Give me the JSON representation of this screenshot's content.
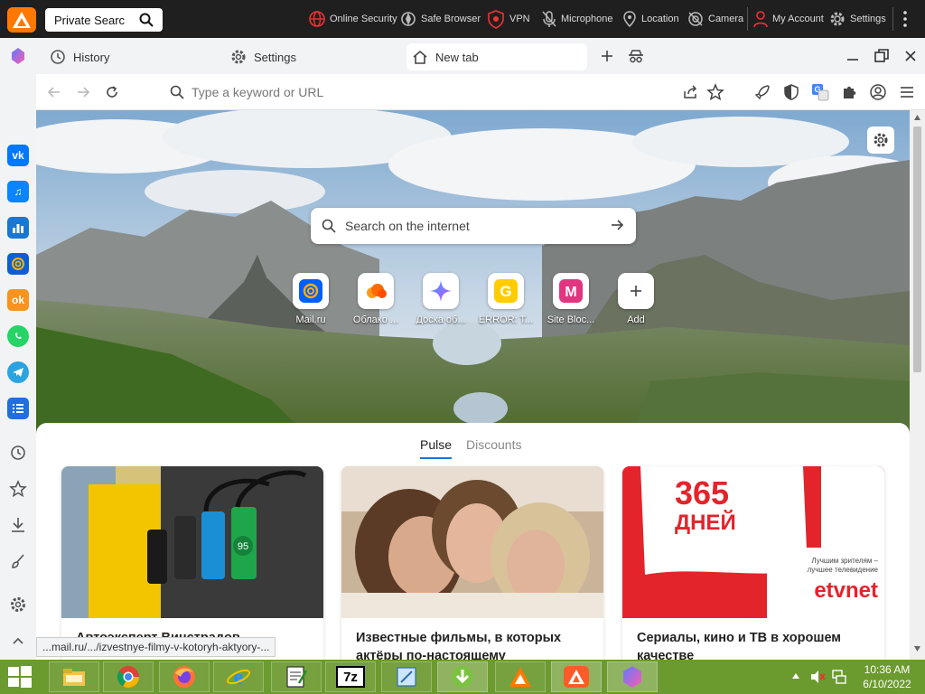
{
  "topbar": {
    "search_value": "Private Searc",
    "items": [
      {
        "label": "Online Security"
      },
      {
        "label": "Safe Browser"
      },
      {
        "label": "VPN"
      },
      {
        "label": "Microphone"
      },
      {
        "label": "Location"
      },
      {
        "label": "Camera"
      },
      {
        "label": "My Account"
      },
      {
        "label": "Settings"
      }
    ]
  },
  "tabs": {
    "history_label": "History",
    "settings_label": "Settings",
    "active_tab_label": "New tab"
  },
  "addressbar": {
    "placeholder": "Type a keyword or URL"
  },
  "newtab": {
    "search_placeholder": "Search on the internet",
    "tiles": [
      {
        "label": "Mail.ru",
        "color": "#005ff9"
      },
      {
        "label": "Облако ...",
        "color": "#ff6a00"
      },
      {
        "label": "Доска об...",
        "color": "#7b61ff"
      },
      {
        "label": "ERROR: T...",
        "color": "#ffcc00"
      },
      {
        "label": "Site Bloc...",
        "color": "#e2357f"
      },
      {
        "label": "Add",
        "color": "#444444"
      }
    ],
    "feed_tabs": {
      "pulse": "Pulse",
      "discounts": "Discounts"
    },
    "cards": [
      {
        "title": "Автоэксперт Винстрадов"
      },
      {
        "title": "Известные фильмы, в которых актёры по-настоящему"
      },
      {
        "title": "Сериалы, кино и ТВ в хорошем качестве"
      }
    ],
    "ad": {
      "big": "365",
      "big2": "ДНЕЙ",
      "tagline1": "Лучшим зрителям –",
      "tagline2": "лучшее телевидение",
      "brand": "etvnet"
    },
    "fuel_label": "95"
  },
  "status_url": "...mail.ru/.../izvestnye-filmy-v-kotoryh-aktyory-...",
  "taskbar": {
    "time": "10:36 AM",
    "date": "6/10/2022",
    "sevenzip_label": "7z"
  },
  "colors": {
    "accent": "#1a73e8",
    "taskbar": "#6b9a2e",
    "avast_orange": "#ff7800"
  }
}
